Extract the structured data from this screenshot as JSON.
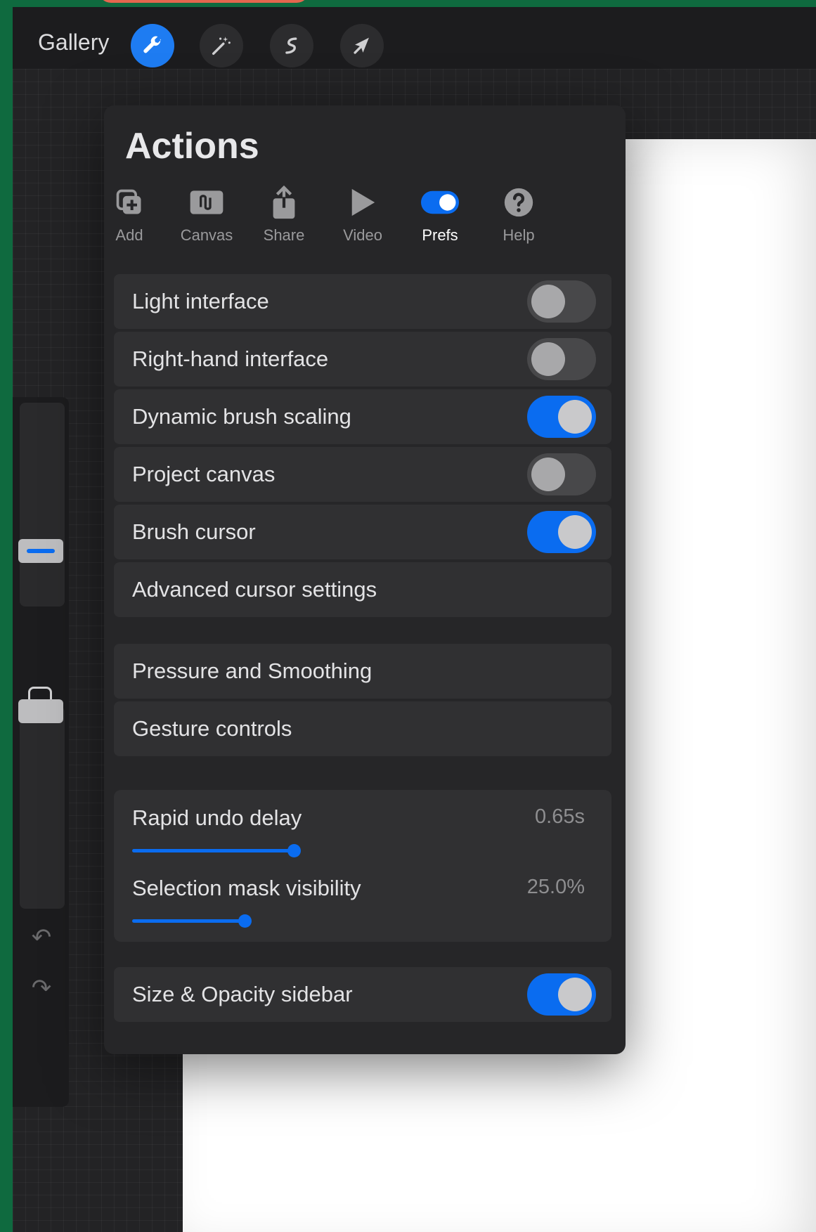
{
  "toolbar": {
    "gallery_label": "Gallery",
    "tools": [
      "wrench-icon",
      "magic-wand-icon",
      "selection-icon",
      "transform-arrow-icon"
    ],
    "active_tool": "wrench-icon"
  },
  "actions": {
    "title": "Actions",
    "tabs": [
      {
        "label": "Add",
        "icon": "add-icon"
      },
      {
        "label": "Canvas",
        "icon": "canvas-icon"
      },
      {
        "label": "Share",
        "icon": "share-icon"
      },
      {
        "label": "Video",
        "icon": "video-play-icon"
      },
      {
        "label": "Prefs",
        "icon": "prefs-toggle-icon"
      },
      {
        "label": "Help",
        "icon": "help-icon"
      }
    ],
    "active_tab": "Prefs"
  },
  "prefs": {
    "toggles": [
      {
        "label": "Light interface",
        "on": false
      },
      {
        "label": "Right-hand interface",
        "on": false
      },
      {
        "label": "Dynamic brush scaling",
        "on": true
      },
      {
        "label": "Project canvas",
        "on": false
      },
      {
        "label": "Brush cursor",
        "on": true
      }
    ],
    "advanced_cursor": "Advanced cursor settings",
    "pressure_smoothing": "Pressure and Smoothing",
    "gesture_controls": "Gesture controls",
    "sliders": [
      {
        "label": "Rapid undo delay",
        "value": "0.65s",
        "fraction": 0.36
      },
      {
        "label": "Selection mask visibility",
        "value": "25.0%",
        "fraction": 0.25
      }
    ],
    "sidebar_toggle": {
      "label": "Size & Opacity sidebar",
      "on": true
    }
  },
  "colors": {
    "accent": "#0a6cf0",
    "panel": "#262628",
    "row": "#303032"
  }
}
